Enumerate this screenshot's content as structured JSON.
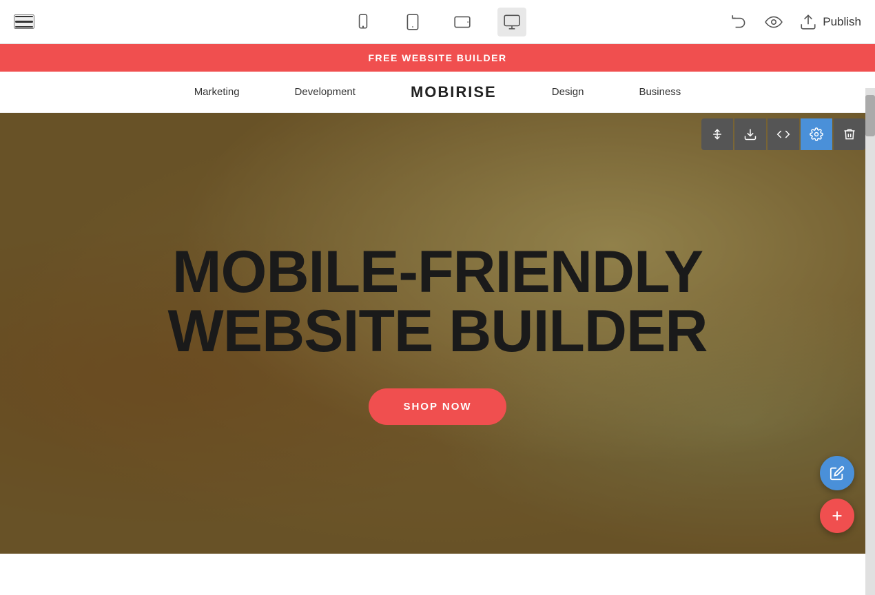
{
  "toolbar": {
    "menu_label": "Menu",
    "publish_label": "Publish",
    "devices": [
      {
        "id": "mobile",
        "label": "Mobile view"
      },
      {
        "id": "tablet",
        "label": "Tablet view"
      },
      {
        "id": "tablet-landscape",
        "label": "Tablet landscape view"
      },
      {
        "id": "desktop",
        "label": "Desktop view"
      }
    ],
    "active_device": "desktop"
  },
  "promo_banner": {
    "text": "FREE WEBSITE BUILDER"
  },
  "site_nav": {
    "logo": "MOBIRISE",
    "links": [
      {
        "label": "Marketing",
        "href": "#"
      },
      {
        "label": "Development",
        "href": "#"
      },
      {
        "label": "Design",
        "href": "#"
      },
      {
        "label": "Business",
        "href": "#"
      }
    ]
  },
  "hero": {
    "title_line1": "MOBILE-FRIENDLY",
    "title_line2": "WEBSITE BUILDER",
    "cta_label": "SHOP NOW"
  },
  "block_controls": [
    {
      "id": "move",
      "label": "Move block"
    },
    {
      "id": "download",
      "label": "Download block"
    },
    {
      "id": "code",
      "label": "Code block"
    },
    {
      "id": "settings",
      "label": "Block settings"
    },
    {
      "id": "delete",
      "label": "Delete block"
    }
  ],
  "fab": {
    "edit_label": "Edit",
    "add_label": "Add block"
  },
  "colors": {
    "accent_red": "#f04f4f",
    "accent_blue": "#4a90d9",
    "toolbar_bg": "#ffffff",
    "nav_bg": "#ffffff"
  }
}
